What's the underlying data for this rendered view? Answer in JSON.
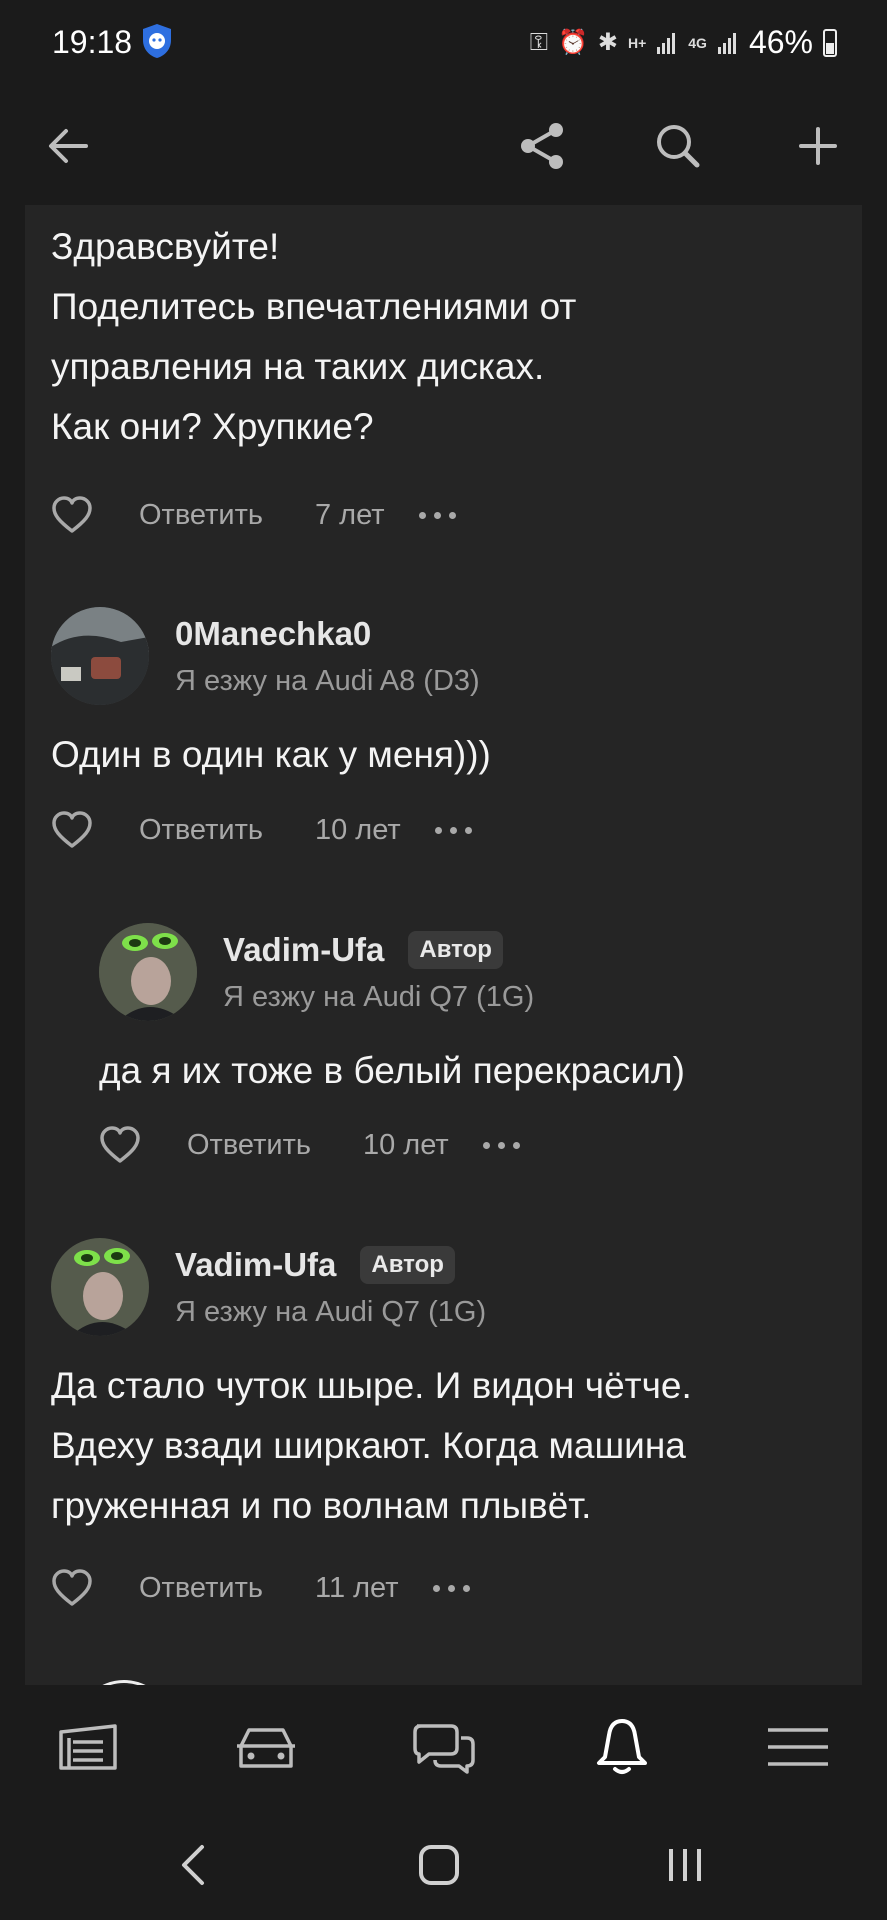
{
  "status_bar": {
    "time": "19:18",
    "network": "4G",
    "data_type": "H+",
    "battery": "46%"
  },
  "post": {
    "lines": [
      "Здравсвуйте!",
      "Поделитесь впечатлениями от",
      "управления на таких дисках.",
      "Как они? Хрупкие?"
    ],
    "reply_label": "Ответить",
    "age": "7 лет"
  },
  "comments": [
    {
      "author": "0Manechka0",
      "car": "Я езжу на Audi A8 (D3)",
      "lines": [
        "Один в один как у меня)))"
      ],
      "reply_label": "Ответить",
      "age": "10 лет"
    },
    {
      "author": "Vadim-Ufa",
      "badge": "Автор",
      "car": "Я езжу на Audi Q7 (1G)",
      "lines": [
        "да я их тоже в белый перекрасил)"
      ],
      "reply_label": "Ответить",
      "age": "10 лет"
    },
    {
      "author": "Vadim-Ufa",
      "badge": "Автор",
      "car": "Я езжу на Audi Q7 (1G)",
      "lines": [
        "Да стало чуток шыре. И видон чётче.",
        "Вдеху взади ширкают. Когда машина",
        "груженная и по волнам плывёт."
      ],
      "reply_label": "Ответить",
      "age": "11 лет"
    }
  ],
  "colors": {
    "background": "#1b1b1b",
    "card": "#252525",
    "text": "#f4f4f4",
    "muted": "#a9a9a9",
    "badge_bg": "#3a3a3a"
  },
  "icons": {
    "appbar": [
      "back-arrow-icon",
      "share-icon",
      "search-icon",
      "plus-icon"
    ],
    "bottom_nav": [
      "feed-icon",
      "car-icon",
      "chat-icon",
      "notifications-icon",
      "menu-icon"
    ],
    "system_nav": [
      "back-icon",
      "home-icon",
      "recents-icon"
    ]
  }
}
